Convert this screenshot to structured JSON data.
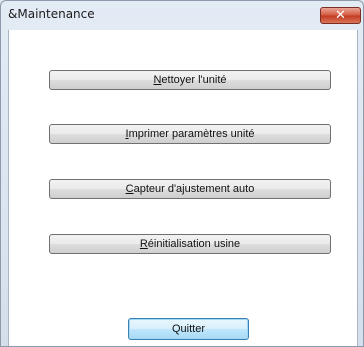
{
  "window": {
    "title": "&Maintenance",
    "close_glyph": "✕"
  },
  "buttons": {
    "clean": {
      "mnemonic": "N",
      "rest": "ettoyer l'unité"
    },
    "print": {
      "mnemonic": "I",
      "rest": "mprimer paramètres unité"
    },
    "sensor": {
      "mnemonic": "C",
      "rest": "apteur d'ajustement auto"
    },
    "reset": {
      "mnemonic": "R",
      "rest": "éinitialisation usine"
    },
    "quit": {
      "label": "Quitter"
    }
  },
  "icons": {
    "close": "close-icon"
  },
  "colors": {
    "frame": "#dfe7f1",
    "close_button": "#c23a20",
    "default_button_border": "#3c7fb1"
  }
}
